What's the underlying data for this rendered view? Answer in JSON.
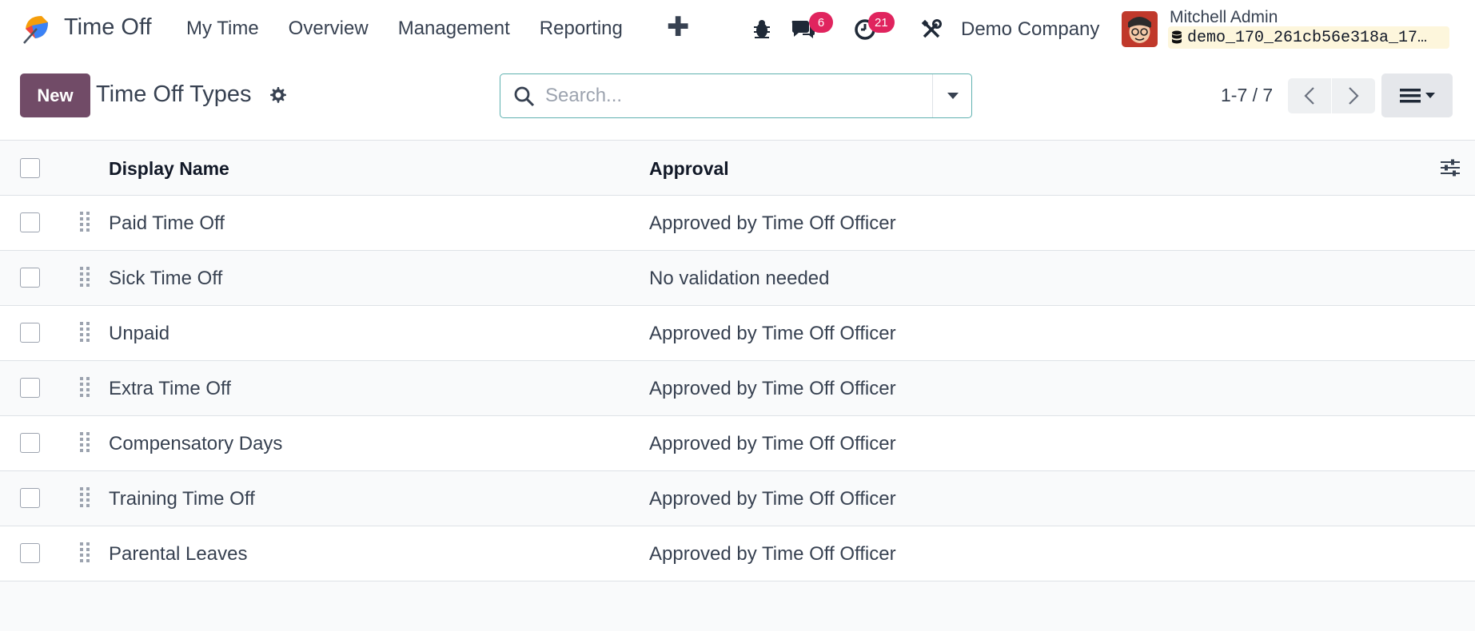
{
  "navbar": {
    "app_name": "Time Off",
    "menu": [
      "My Time",
      "Overview",
      "Management",
      "Reporting"
    ],
    "messages_count": "6",
    "activities_count": "21",
    "company": "Demo Company",
    "user_name": "Mitchell Admin",
    "database": "demo_170_261cb56e318a_17…"
  },
  "control": {
    "new_label": "New",
    "title": "Time Off Types",
    "search_placeholder": "Search...",
    "pager": "1-7 / 7"
  },
  "table": {
    "columns": [
      "Display Name",
      "Approval"
    ],
    "rows": [
      {
        "name": "Paid Time Off",
        "approval": "Approved by Time Off Officer"
      },
      {
        "name": "Sick Time Off",
        "approval": "No validation needed"
      },
      {
        "name": "Unpaid",
        "approval": "Approved by Time Off Officer"
      },
      {
        "name": "Extra Time Off",
        "approval": "Approved by Time Off Officer"
      },
      {
        "name": "Compensatory Days",
        "approval": "Approved by Time Off Officer"
      },
      {
        "name": "Training Time Off",
        "approval": "Approved by Time Off Officer"
      },
      {
        "name": "Parental Leaves",
        "approval": "Approved by Time Off Officer"
      }
    ]
  },
  "colors": {
    "primary": "#714b67",
    "badge": "#e0245e",
    "search_border": "#5fb1b0"
  }
}
